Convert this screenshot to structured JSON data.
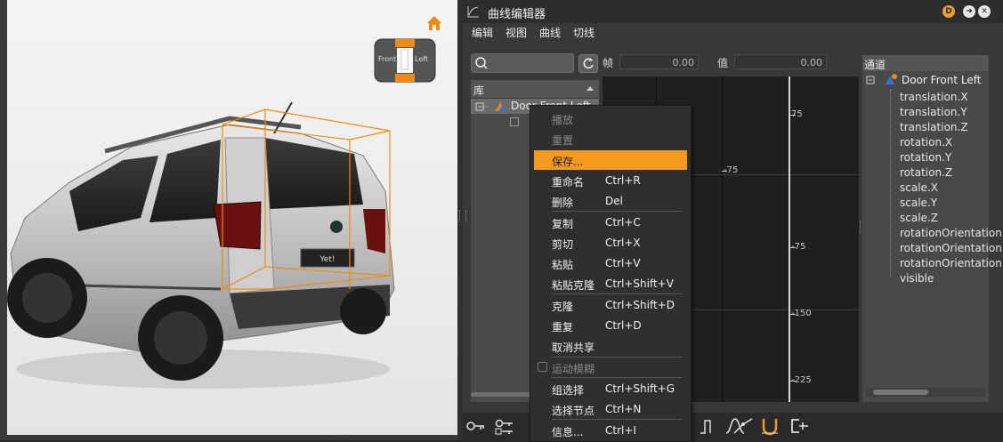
{
  "viewport": {
    "viewcube": {
      "front_label": "Front",
      "left_label": "Left"
    },
    "bottom_status": "... ..."
  },
  "editor": {
    "title": "曲线编辑器",
    "title_buttons": {
      "d": "D",
      "arrow": "➜",
      "close": "✕"
    },
    "menu": [
      "编辑",
      "视图",
      "曲线",
      "切线"
    ],
    "toolbar": {
      "search_placeholder": "",
      "frame_label": "帧",
      "frame_value": "0.00",
      "value_label": "值",
      "value_value": "0.00"
    },
    "library": {
      "header": "库",
      "selected_item": "Door Front Left"
    },
    "graph": {
      "labels_right": [
        "75",
        "-75",
        "-150",
        "-225"
      ],
      "labels_left": [
        "-75"
      ]
    },
    "channels": {
      "header": "通道",
      "root": "Door Front Left",
      "items": [
        "translation.X",
        "translation.Y",
        "translation.Z",
        "rotation.X",
        "rotation.Y",
        "rotation.Z",
        "scale.X",
        "scale.Y",
        "scale.Z",
        "rotationOrientation",
        "rotationOrientation",
        "rotationOrientation",
        "visible"
      ]
    }
  },
  "context_menu": {
    "items": [
      {
        "label": "播放",
        "shortcut": "",
        "disabled": true
      },
      {
        "label": "重置",
        "shortcut": "",
        "disabled": true
      },
      {
        "label": "保存...",
        "shortcut": "",
        "active": true
      },
      {
        "label": "重命名",
        "shortcut": "Ctrl+R"
      },
      {
        "label": "删除",
        "shortcut": "Del"
      },
      {
        "label": "复制",
        "shortcut": "Ctrl+C"
      },
      {
        "label": "剪切",
        "shortcut": "Ctrl+X"
      },
      {
        "label": "粘贴",
        "shortcut": "Ctrl+V"
      },
      {
        "label": "粘贴克隆",
        "shortcut": "Ctrl+Shift+V"
      },
      {
        "label": "克隆",
        "shortcut": "Ctrl+Shift+D"
      },
      {
        "label": "重复",
        "shortcut": "Ctrl+D"
      },
      {
        "label": "取消共享",
        "shortcut": ""
      },
      {
        "label": "运动模糊",
        "shortcut": "",
        "disabled": true,
        "checkbox": true
      },
      {
        "label": "组选择",
        "shortcut": "Ctrl+Shift+G"
      },
      {
        "label": "选择节点",
        "shortcut": "Ctrl+N"
      },
      {
        "label": "信息...",
        "shortcut": "Ctrl+I"
      }
    ]
  },
  "colors": {
    "accent": "#f39a1d",
    "bbox": "#f08a10"
  },
  "icons": [
    "home-icon",
    "viewcube-icon",
    "curve-editor-icon",
    "search-icon",
    "refresh-icon",
    "key-icon",
    "keys-icon",
    "tangent-icon",
    "magnet-icon"
  ]
}
